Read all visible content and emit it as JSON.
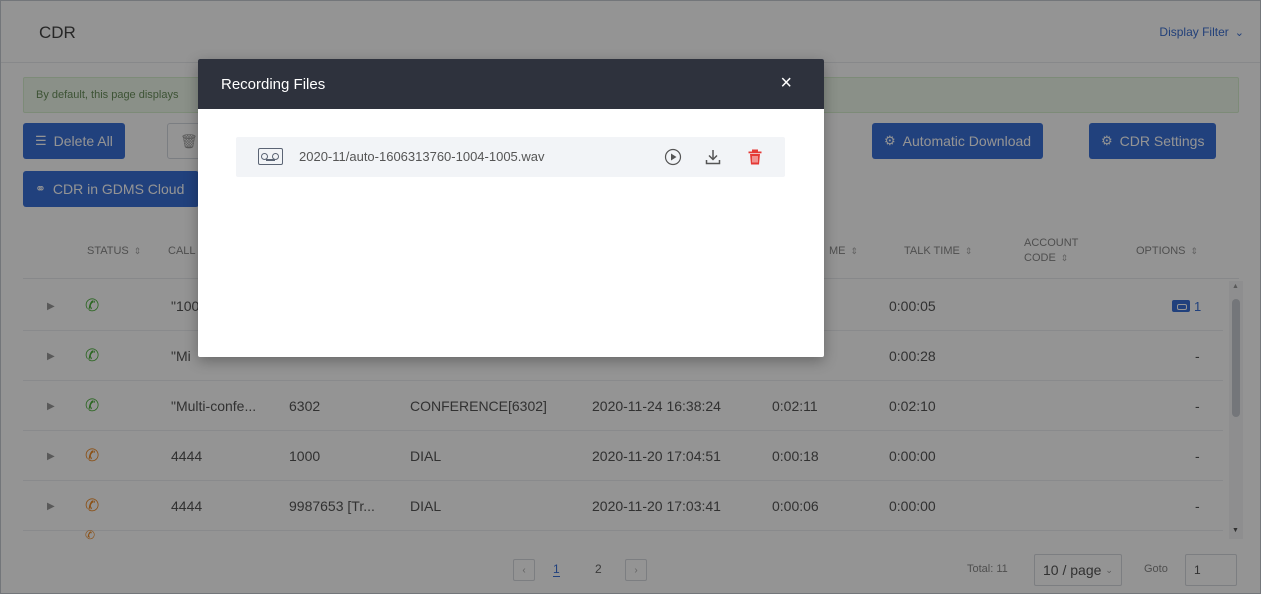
{
  "page": {
    "title": "CDR",
    "display_filter": "Display Filter",
    "info_text": "By default, this page displays"
  },
  "toolbar": {
    "delete_all": "Delete All",
    "automatic_download": "Automatic Download",
    "cdr_settings": "CDR Settings",
    "cdr_gdms": "CDR in GDMS Cloud"
  },
  "table": {
    "headers": {
      "status": "STATUS",
      "caller": "CALL",
      "ring_time": "ME",
      "talk_time": "TALK TIME",
      "account_code_1": "ACCOUNT",
      "account_code_2": "CODE",
      "options": "OPTIONS"
    },
    "rows": [
      {
        "status": "answered",
        "caller": "\"100",
        "callee": "",
        "action": "",
        "start": "",
        "ring": "",
        "talk": "0:00:05",
        "options": "1"
      },
      {
        "status": "answered",
        "caller": "\"Mi",
        "callee": "",
        "action": "",
        "start": "",
        "ring": "",
        "talk": "0:00:28",
        "options": "-"
      },
      {
        "status": "answered",
        "caller": "\"Multi-confe...",
        "callee": "6302",
        "action": "CONFERENCE[6302]",
        "start": "2020-11-24 16:38:24",
        "ring": "0:02:11",
        "talk": "0:02:10",
        "options": "-"
      },
      {
        "status": "missed",
        "caller": "4444",
        "callee": "1000",
        "action": "DIAL",
        "start": "2020-11-20 17:04:51",
        "ring": "0:00:18",
        "talk": "0:00:00",
        "options": "-"
      },
      {
        "status": "missed",
        "caller": "4444",
        "callee": "9987653 [Tr...",
        "action": "DIAL",
        "start": "2020-11-20 17:03:41",
        "ring": "0:00:06",
        "talk": "0:00:00",
        "options": "-"
      }
    ]
  },
  "pagination": {
    "pages": [
      "1",
      "2"
    ],
    "current": "1",
    "total": "Total: 11",
    "page_size": "10 / page",
    "goto_label": "Goto",
    "goto_value": "1"
  },
  "modal": {
    "title": "Recording Files",
    "close_glyph": "×",
    "files": [
      {
        "name": "2020-11/auto-1606313760-1004-1005.wav"
      }
    ]
  },
  "colors": {
    "primary": "#3a70d8",
    "answered": "#4bb03a",
    "missed": "#f08a24",
    "danger": "#e53935",
    "modal_header": "#2e323d"
  },
  "icons": {
    "status_answered": "phone-icon",
    "status_missed": "missed-call-icon",
    "file": "tape-icon",
    "play": "play-icon",
    "download": "download-icon",
    "delete": "trash-icon"
  }
}
